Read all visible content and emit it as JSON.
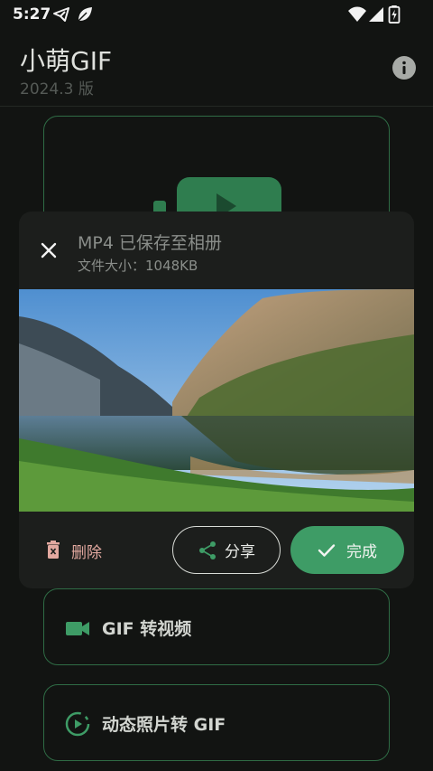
{
  "status_bar": {
    "time": "5:27",
    "left_icons": [
      "telegram-icon",
      "leaf-icon"
    ],
    "right_icons": [
      "wifi-icon",
      "signal-icon",
      "battery-charging-icon"
    ]
  },
  "header": {
    "title": "小萌GIF",
    "subtitle": "2024.3 版",
    "info_icon": "info-icon"
  },
  "menu": {
    "items": [
      {
        "label": "GIF 转视频",
        "icon": "video-camera-icon"
      },
      {
        "label": "动态照片转 GIF",
        "icon": "motion-photo-icon"
      }
    ]
  },
  "dialog": {
    "title": "MP4 已保存至相册",
    "subtitle": "文件大小：1048KB",
    "close_icon": "close-icon",
    "delete_label": "删除",
    "share_label": "分享",
    "done_label": "完成"
  },
  "colors": {
    "accent": "#3e9c66",
    "card_border": "#2f6c45",
    "delete": "#e3a9a0",
    "background": "#121412",
    "dialog": "#1c1e1c"
  }
}
